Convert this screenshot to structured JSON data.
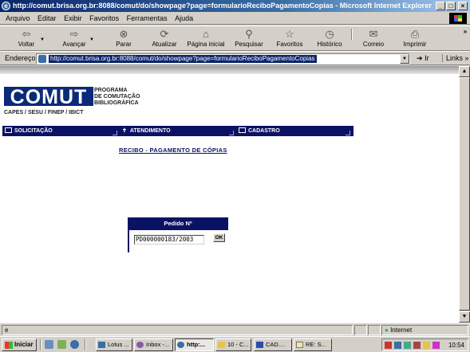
{
  "window": {
    "title": "http://comut.brisa.org.br:8088/comut/do/showpage?page=formularioReciboPagamentoCopias - Microsoft Internet Explorer",
    "buttons": [
      "_",
      "□",
      "×"
    ]
  },
  "menu": {
    "items": [
      "Arquivo",
      "Editar",
      "Exibir",
      "Favoritos",
      "Ferramentas",
      "Ajuda"
    ]
  },
  "toolbar": {
    "buttons": [
      {
        "label": "Voltar",
        "icon": "back-arrow-icon"
      },
      {
        "label": "Avançar",
        "icon": "forward-arrow-icon"
      },
      {
        "label": "Parar",
        "icon": "stop-icon"
      },
      {
        "label": "Atualizar",
        "icon": "refresh-icon"
      },
      {
        "label": "Página inicial",
        "icon": "home-icon"
      },
      {
        "label": "Pesquisar",
        "icon": "search-icon"
      },
      {
        "label": "Favoritos",
        "icon": "favorites-icon"
      },
      {
        "label": "Histórico",
        "icon": "history-icon"
      },
      {
        "label": "Correio",
        "icon": "mail-icon"
      },
      {
        "label": "Imprimir",
        "icon": "print-icon"
      }
    ],
    "overflow": "»"
  },
  "address": {
    "label": "Endereço",
    "url": "http://comut.brisa.org.br:8088/comut/do/showpage?page=formularioReciboPagamentoCopias",
    "go_label": "Ir",
    "links_label": "Links »"
  },
  "page": {
    "logo": {
      "wordmark": "COMUT",
      "program_lines": [
        "PROGRAMA",
        "DE COMUTAÇÃO",
        "BIBLIOGRÁFICA"
      ],
      "partners": "CAPES / SESU / FINEP / IBICT"
    },
    "nav": [
      {
        "label": "SOLICITAÇÃO",
        "icon": "screen-icon"
      },
      {
        "label": "ATENDIMENTO",
        "icon": "person-icon"
      },
      {
        "label": "CADASTRO",
        "icon": "document-icon"
      }
    ],
    "title": "RECIBO - PAGAMENTO DE CÓPIAS",
    "form": {
      "header": "Pedido Nº",
      "pedido_value": "PD000000183/2003",
      "ok_label": "OK"
    }
  },
  "status": {
    "text": "",
    "zone": "Internet"
  },
  "taskbar": {
    "start_label": "Iniciar",
    "tasks": [
      {
        "label": "Lotus ...",
        "active": false
      },
      {
        "label": "Inbox -...",
        "active": false
      },
      {
        "label": "http:...",
        "active": true
      },
      {
        "label": "10 - C...",
        "active": false
      },
      {
        "label": "CAD....",
        "active": false
      },
      {
        "label": "RE: S...",
        "active": false
      }
    ],
    "clock": "10:54"
  },
  "colors": {
    "title_bar": "#0a246a",
    "nav_bar": "#0b1263",
    "comut_logo": "#0a2a7a"
  }
}
